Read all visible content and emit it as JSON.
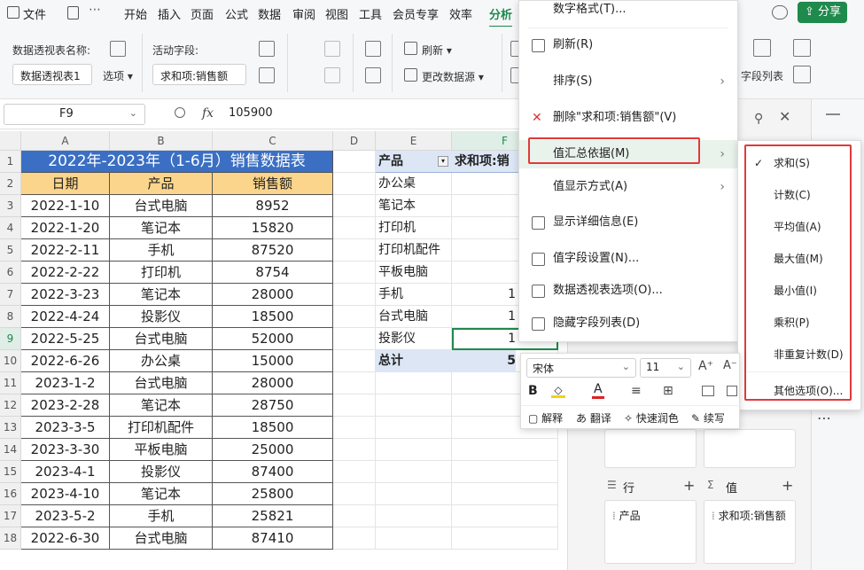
{
  "menubar": {
    "file": "文件",
    "tabs": [
      "开始",
      "插入",
      "页面",
      "公式",
      "数据",
      "审阅",
      "视图",
      "工具",
      "会员专享",
      "效率",
      "分析"
    ],
    "share": "分享"
  },
  "toolbar": {
    "pivot_name_label": "数据透视表名称:",
    "pivot_name_value": "数据透视表1",
    "options_label": "选项",
    "active_field_label": "活动字段:",
    "active_field_value": "求和项:销售额",
    "refresh_label": "刷新",
    "change_source_label": "更改数据源",
    "field_list_label": "字段列表"
  },
  "formula": {
    "cell_ref": "F9",
    "fx": "fx",
    "value": "105900"
  },
  "columns": [
    "A",
    "B",
    "C",
    "D",
    "E",
    "F"
  ],
  "rows": [
    "1",
    "2",
    "3",
    "4",
    "5",
    "6",
    "7",
    "8",
    "9",
    "10",
    "11",
    "12",
    "13",
    "14",
    "15",
    "16",
    "17",
    "18"
  ],
  "table": {
    "title": "2022年-2023年（1-6月）销售数据表",
    "headers": [
      "日期",
      "产品",
      "销售额"
    ],
    "data": [
      [
        "2022-1-10",
        "台式电脑",
        "8952"
      ],
      [
        "2022-1-20",
        "笔记本",
        "15820"
      ],
      [
        "2022-2-11",
        "手机",
        "87520"
      ],
      [
        "2022-2-22",
        "打印机",
        "8754"
      ],
      [
        "2022-3-23",
        "笔记本",
        "28000"
      ],
      [
        "2022-4-24",
        "投影仪",
        "18500"
      ],
      [
        "2022-5-25",
        "台式电脑",
        "52000"
      ],
      [
        "2022-6-26",
        "办公桌",
        "15000"
      ],
      [
        "2023-1-2",
        "台式电脑",
        "28000"
      ],
      [
        "2023-2-28",
        "笔记本",
        "28750"
      ],
      [
        "2023-3-5",
        "打印机配件",
        "18500"
      ],
      [
        "2023-3-30",
        "平板电脑",
        "25000"
      ],
      [
        "2023-4-1",
        "投影仪",
        "87400"
      ],
      [
        "2023-4-10",
        "笔记本",
        "25800"
      ],
      [
        "2023-5-2",
        "手机",
        "25821"
      ],
      [
        "2022-6-30",
        "台式电脑",
        "87410"
      ]
    ]
  },
  "pivot": {
    "header_product": "产品",
    "header_sum": "求和项:销",
    "items": [
      "办公桌",
      "笔记本",
      "打印机",
      "打印机配件",
      "平板电脑",
      "手机",
      "台式电脑",
      "投影仪"
    ],
    "partial_values": {
      "手机": "1",
      "台式电脑": "1",
      "投影仪": "1"
    },
    "total_label": "总计",
    "total_partial": "5"
  },
  "context_menu": {
    "items": [
      {
        "label": "数字格式(T)...",
        "arrow": false
      },
      {
        "label": "刷新(R)",
        "arrow": false
      },
      {
        "label": "排序(S)",
        "arrow": true
      },
      {
        "label": "删除\"求和项:销售额\"(V)",
        "arrow": false
      },
      {
        "label": "值汇总依据(M)",
        "arrow": true
      },
      {
        "label": "值显示方式(A)",
        "arrow": true
      },
      {
        "label": "显示详细信息(E)",
        "arrow": false
      },
      {
        "label": "值字段设置(N)...",
        "arrow": false
      },
      {
        "label": "数据透视表选项(O)...",
        "arrow": false
      },
      {
        "label": "隐藏字段列表(D)",
        "arrow": false
      }
    ]
  },
  "submenu": {
    "items": [
      "求和(S)",
      "计数(C)",
      "平均值(A)",
      "最大值(M)",
      "最小值(I)",
      "乘积(P)",
      "非重复计数(D)",
      "其他选项(O)..."
    ],
    "checked": "求和(S)"
  },
  "mini_toolbar": {
    "font": "宋体",
    "size": "11",
    "bold": "B",
    "actions": [
      "解释",
      "翻译",
      "快速润色",
      "续写"
    ]
  },
  "field_panel": {
    "rows_label": "行",
    "values_label": "值",
    "row_field": "产品",
    "value_field": "求和项:销售额"
  },
  "colors": {
    "accent": "#1e8a4c",
    "title_bg": "#3a6fc4",
    "header_bg": "#fbd58b",
    "highlight": "#e03a3a",
    "pivot_total_bg": "#dce6f5"
  }
}
